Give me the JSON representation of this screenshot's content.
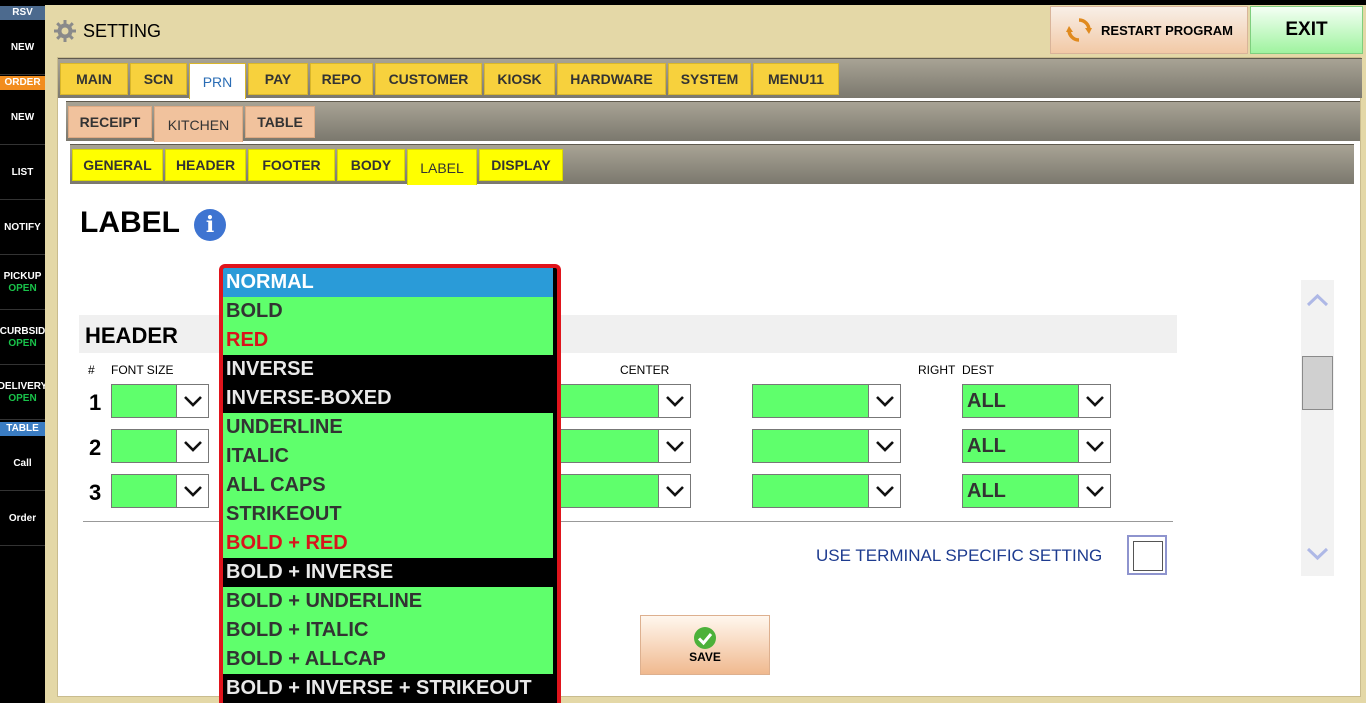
{
  "sidebar": {
    "rsv_header": "RSV",
    "order_header": "ORDER",
    "table_header": "TABLE",
    "items": [
      {
        "label": "NEW",
        "sub": ""
      },
      {
        "label": "NEW",
        "sub": ""
      },
      {
        "label": "LIST",
        "sub": ""
      },
      {
        "label": "NOTIFY",
        "sub": ""
      },
      {
        "label": "PICKUP",
        "sub": "OPEN"
      },
      {
        "label": "CURBSID",
        "sub": "OPEN"
      },
      {
        "label": "DELIVERY",
        "sub": "OPEN"
      },
      {
        "label": "Call",
        "sub": ""
      },
      {
        "label": "Order",
        "sub": ""
      }
    ]
  },
  "window": {
    "title": "SETTING",
    "restart_label": "RESTART PROGRAM",
    "exit_label": "EXIT"
  },
  "tabs_main": [
    "MAIN",
    "SCN",
    "PRN",
    "PAY",
    "REPO",
    "CUSTOMER",
    "KIOSK",
    "HARDWARE",
    "SYSTEM",
    "MENU11"
  ],
  "tabs_main_active": "PRN",
  "tabs_prn": [
    "RECEIPT",
    "KITCHEN",
    "TABLE"
  ],
  "tabs_prn_active": "KITCHEN",
  "tabs_kitchen": [
    "GENERAL",
    "HEADER",
    "FOOTER",
    "BODY",
    "LABEL",
    "DISPLAY"
  ],
  "tabs_kitchen_active": "LABEL",
  "page": {
    "title": "LABEL",
    "info_icon": "i",
    "section_title": "HEADER",
    "columns": {
      "num": "#",
      "font_size": "FONT SIZE",
      "center": "CENTER",
      "right": "RIGHT",
      "dest": "DEST"
    },
    "rows": [
      {
        "num": "1",
        "dest": "ALL"
      },
      {
        "num": "2",
        "dest": "ALL"
      },
      {
        "num": "3",
        "dest": "ALL"
      }
    ],
    "terminal_label": "USE TERMINAL SPECIFIC SETTING",
    "save_label": "SAVE"
  },
  "dropdown": {
    "selected": "NORMAL",
    "options": [
      {
        "label": "NORMAL",
        "style": "sel"
      },
      {
        "label": "BOLD",
        "style": "green"
      },
      {
        "label": "RED",
        "style": "green red"
      },
      {
        "label": "INVERSE",
        "style": "black"
      },
      {
        "label": "INVERSE-BOXED",
        "style": "black"
      },
      {
        "label": "UNDERLINE",
        "style": "green"
      },
      {
        "label": "ITALIC",
        "style": "green"
      },
      {
        "label": "ALL CAPS",
        "style": "green"
      },
      {
        "label": "STRIKEOUT",
        "style": "green"
      },
      {
        "label": "BOLD + RED",
        "style": "green red"
      },
      {
        "label": "BOLD + INVERSE",
        "style": "black"
      },
      {
        "label": "BOLD + UNDERLINE",
        "style": "green"
      },
      {
        "label": "BOLD + ITALIC",
        "style": "green"
      },
      {
        "label": "BOLD + ALLCAP",
        "style": "green"
      },
      {
        "label": "BOLD + INVERSE + STRIKEOUT",
        "style": "black"
      }
    ]
  },
  "colors": {
    "sidebar_accent": "#f28d1e",
    "sidebar_table": "#3a7cc2",
    "open_green": "#19c24a",
    "combo_green": "#5fff6c",
    "dropdown_border": "#e0141c",
    "selected_blue": "#2a9bd8"
  }
}
